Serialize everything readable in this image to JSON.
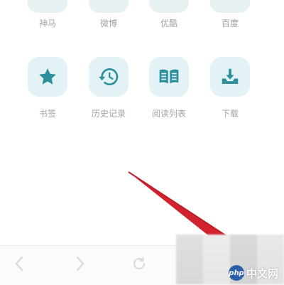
{
  "top_shortcuts": [
    {
      "label": "神马"
    },
    {
      "label": "微博"
    },
    {
      "label": "优酷"
    },
    {
      "label": "百度"
    }
  ],
  "shortcuts": [
    {
      "label": "书签",
      "icon": "star-icon"
    },
    {
      "label": "历史记录",
      "icon": "history-icon"
    },
    {
      "label": "阅读列表",
      "icon": "reading-list-icon"
    },
    {
      "label": "下载",
      "icon": "download-icon"
    }
  ],
  "toolbar": {
    "back_icon": "back-arrow-icon",
    "forward_icon": "forward-arrow-icon",
    "refresh_icon": "refresh-icon"
  },
  "watermark": {
    "badge": "php",
    "text": "中文网"
  },
  "colors": {
    "tile_bg": "#e3f3f5",
    "icon_teal": "#2e8f9c",
    "label_gray": "#a3a3a3",
    "arrow_red": "#d0232f"
  }
}
